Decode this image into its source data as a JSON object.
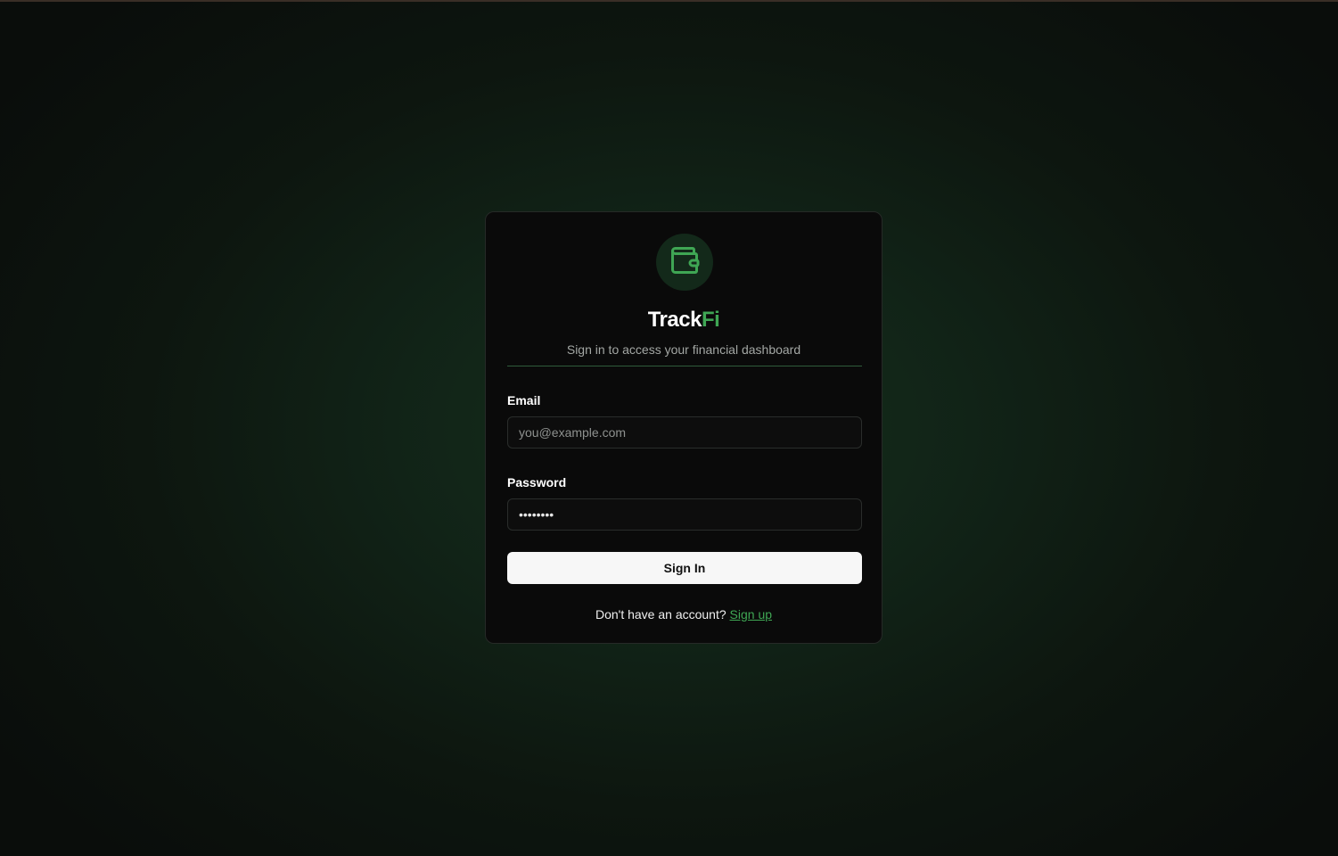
{
  "brand": {
    "name_main": "Track",
    "name_accent": "Fi",
    "logo_icon": "wallet-icon",
    "accent_color": "#3fa654"
  },
  "login": {
    "subtitle": "Sign in to access your financial dashboard",
    "email_label": "Email",
    "email_placeholder": "you@example.com",
    "password_label": "Password",
    "password_value": "••••••••",
    "submit_label": "Sign In",
    "footer_prompt": "Don't have an account?",
    "signup_link": "Sign up"
  }
}
